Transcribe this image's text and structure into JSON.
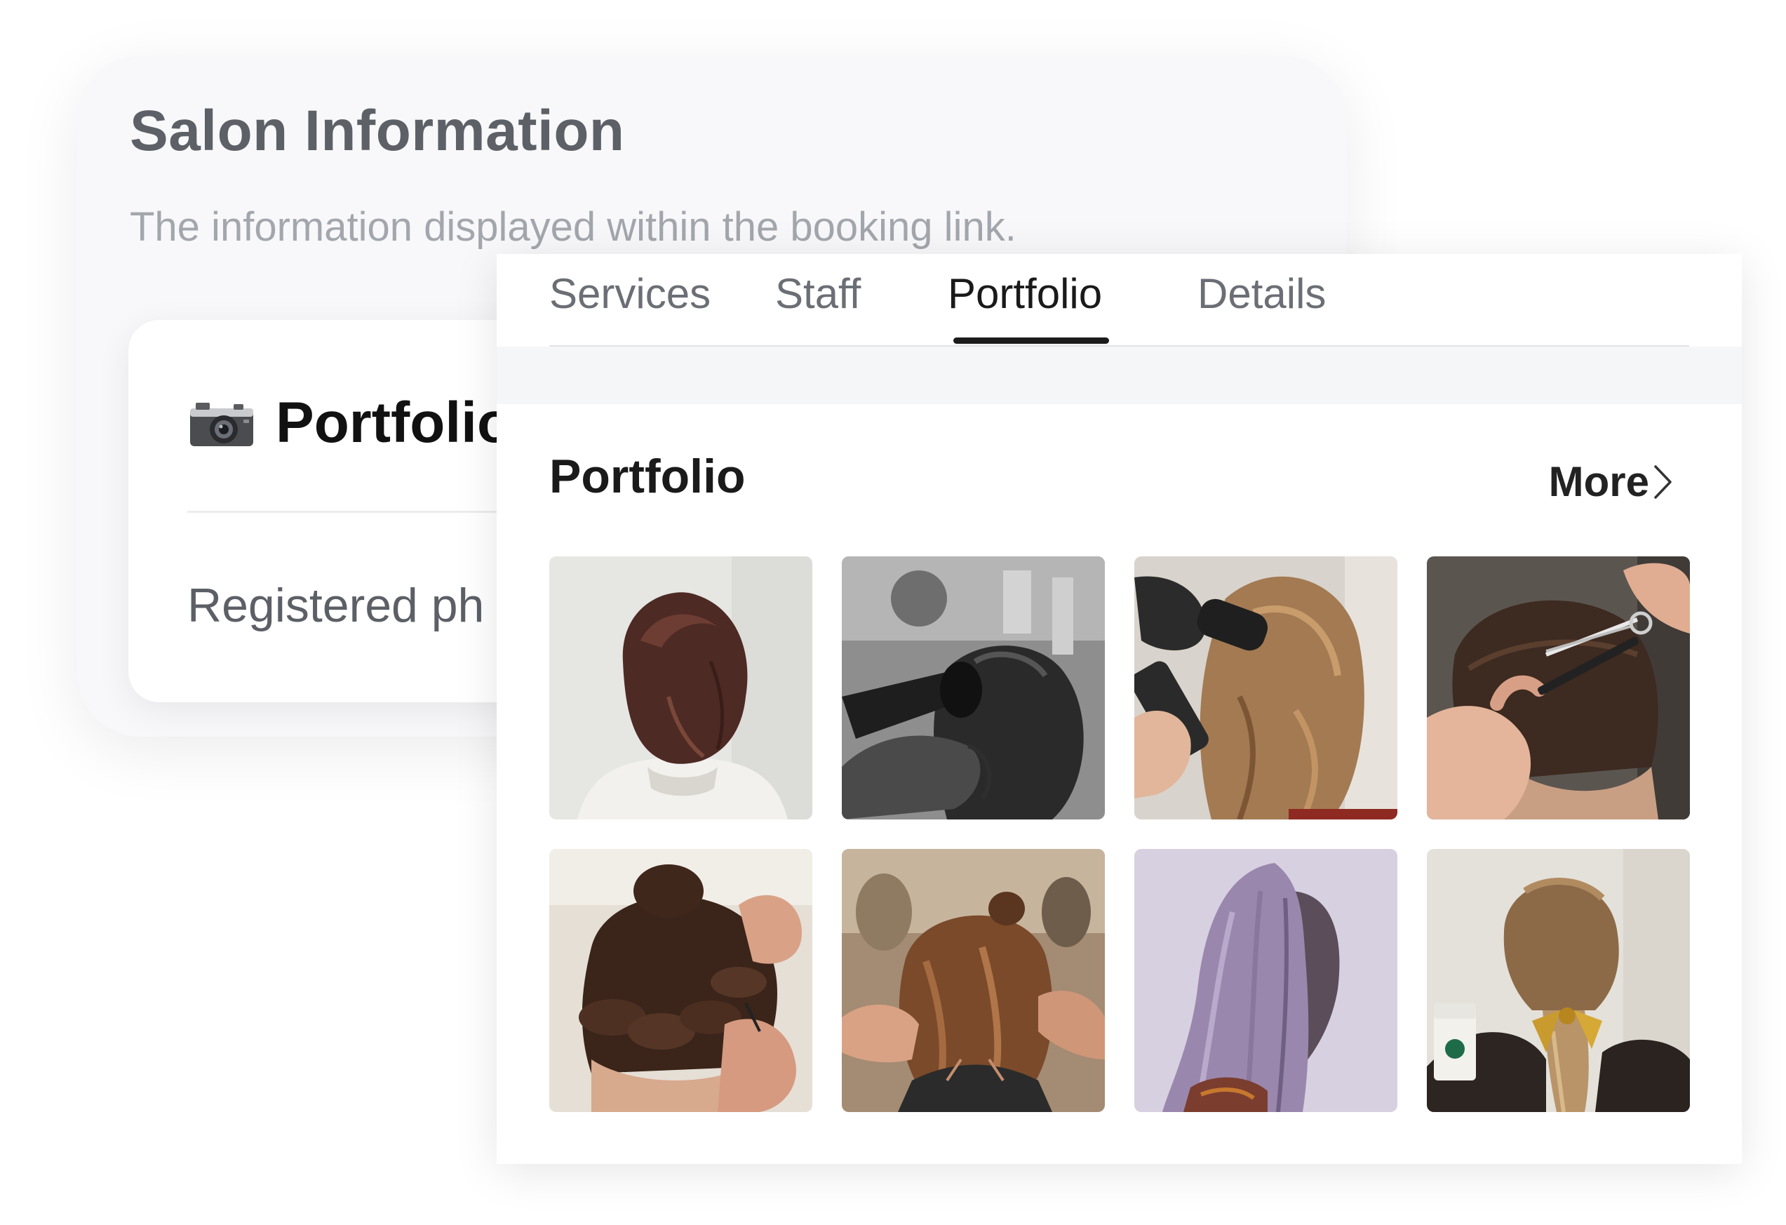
{
  "background_card": {
    "title": "Salon Information",
    "subtitle": "The information displayed within the booking link.",
    "inner_card": {
      "heading": "Portfolio",
      "heading_icon": "camera-icon",
      "subtext": "Registered ph"
    }
  },
  "panel": {
    "tabs": [
      {
        "label": "Services",
        "active": false
      },
      {
        "label": "Staff",
        "active": false
      },
      {
        "label": "Portfolio",
        "active": true
      },
      {
        "label": "Details",
        "active": false
      }
    ],
    "section_title": "Portfolio",
    "more_label": "More",
    "more_icon": "chevron-right-icon",
    "photos": [
      {
        "subject": "bob-haircut-back-view"
      },
      {
        "subject": "blow-dry-black-and-white"
      },
      {
        "subject": "round-brush-blowout"
      },
      {
        "subject": "scissor-haircut"
      },
      {
        "subject": "updo-rollers"
      },
      {
        "subject": "hair-sectioning"
      },
      {
        "subject": "lavender-straight-hair"
      },
      {
        "subject": "ribbon-ponytail"
      }
    ]
  },
  "colors": {
    "active_tab": "#1a1a1a",
    "inactive_tab": "#6b6f75",
    "underline": "#1c1c1c"
  }
}
